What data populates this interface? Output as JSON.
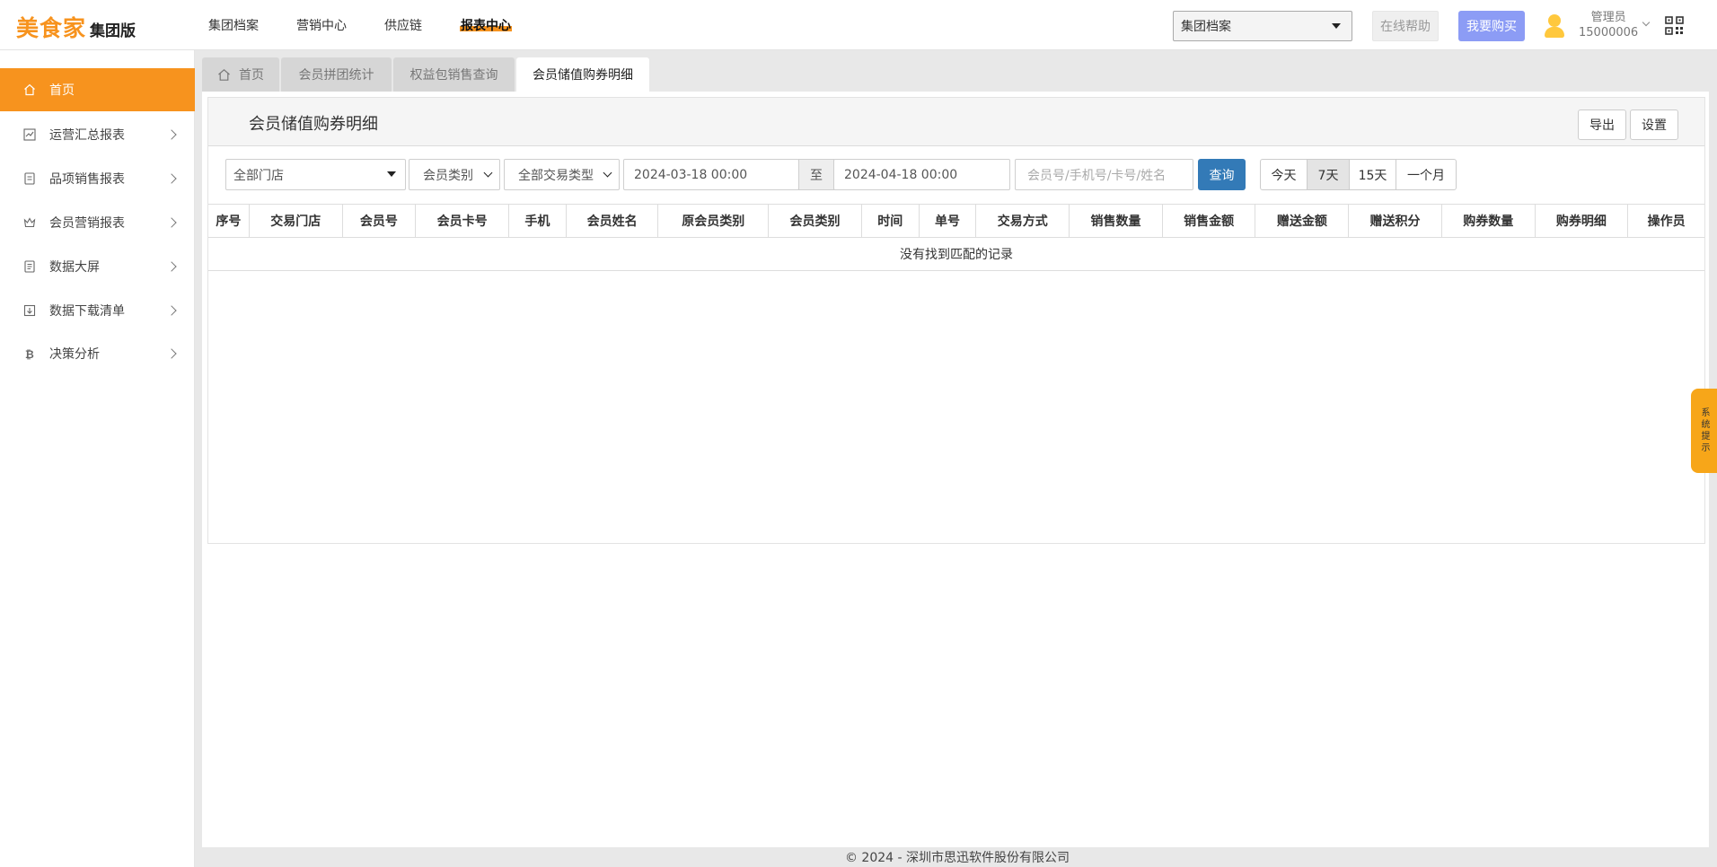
{
  "app": {
    "brand": "美食家",
    "edition": "集团版"
  },
  "topnav": {
    "items": [
      {
        "label": "集团档案"
      },
      {
        "label": "营销中心"
      },
      {
        "label": "供应链"
      },
      {
        "label": "报表中心",
        "active": true
      }
    ],
    "group_select": "集团档案",
    "help_label": "在线帮助",
    "buy_label": "我要购买",
    "user": {
      "role": "管理员",
      "account": "15000006"
    }
  },
  "sidebar": {
    "items": [
      {
        "label": "首页",
        "icon": "home-icon",
        "active": true
      },
      {
        "label": "运营汇总报表",
        "icon": "trend-icon"
      },
      {
        "label": "品项销售报表",
        "icon": "list-doc-icon"
      },
      {
        "label": "会员营销报表",
        "icon": "crown-icon"
      },
      {
        "label": "数据大屏",
        "icon": "screen-icon"
      },
      {
        "label": "数据下载清单",
        "icon": "download-icon"
      },
      {
        "label": "决策分析",
        "icon": "bitcoin-icon"
      }
    ]
  },
  "tabs": [
    {
      "label": "首页",
      "icon": "home-icon"
    },
    {
      "label": "会员拼团统计"
    },
    {
      "label": "权益包销售查询"
    },
    {
      "label": "会员储值购券明细",
      "active": true
    }
  ],
  "panel": {
    "title": "会员储值购券明细",
    "export_label": "导出",
    "settings_label": "设置"
  },
  "filters": {
    "store": "全部门店",
    "member_type": "会员类别",
    "trade_type": "全部交易类型",
    "date_from": "2024-03-18 00:00",
    "to_label": "至",
    "date_to": "2024-04-18 00:00",
    "search_placeholder": "会员号/手机号/卡号/姓名",
    "query_label": "查询",
    "ranges": [
      "今天",
      "7天",
      "15天",
      "一个月"
    ],
    "active_range": "7天"
  },
  "table": {
    "columns": [
      "序号",
      "交易门店",
      "会员号",
      "会员卡号",
      "手机",
      "会员姓名",
      "原会员类别",
      "会员类别",
      "时间",
      "单号",
      "交易方式",
      "销售数量",
      "销售金额",
      "赠送金额",
      "赠送积分",
      "购券数量",
      "购券明细",
      "操作员"
    ],
    "empty_text": "没有找到匹配的记录"
  },
  "footer": "© 2024 - 深圳市思迅软件股份有限公司",
  "side_tip": "系统提示",
  "colors": {
    "accent": "#f7931e",
    "query": "#337ab7",
    "buy": "#8c9cf5"
  }
}
